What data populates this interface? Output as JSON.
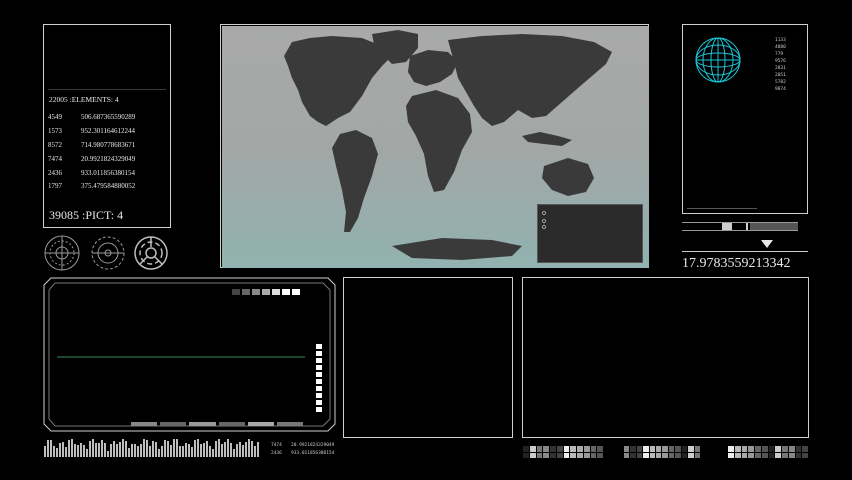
{
  "left_panel": {
    "header": "22005 :ELEMENTS: 4",
    "rows": [
      {
        "a": "4549",
        "b": "506.687365590289"
      },
      {
        "a": "1573",
        "b": "952.301164612244"
      },
      {
        "a": "8572",
        "b": "714.980778683671"
      },
      {
        "a": "7474",
        "b": "20.9921824329049"
      },
      {
        "a": "2436",
        "b": "933.011856380154"
      },
      {
        "a": "1797",
        "b": "375.479584880052"
      }
    ],
    "footer": "39085 :PICT: 4"
  },
  "globe_panel": {
    "numbers": [
      "1133",
      "4880",
      "779",
      "9576",
      "2831",
      "2051",
      "5782",
      "9874"
    ]
  },
  "readout": {
    "value": "17.9783559213342"
  },
  "scope_panel": {
    "bottom_rows": [
      {
        "a": "7474",
        "b": "20.9921824329049"
      },
      {
        "a": "2436",
        "b": "933.011856380154"
      }
    ]
  },
  "colors": {
    "frame": "#cfcfcf",
    "globe": "#19c3d6",
    "trace": "#2e8f5a"
  }
}
